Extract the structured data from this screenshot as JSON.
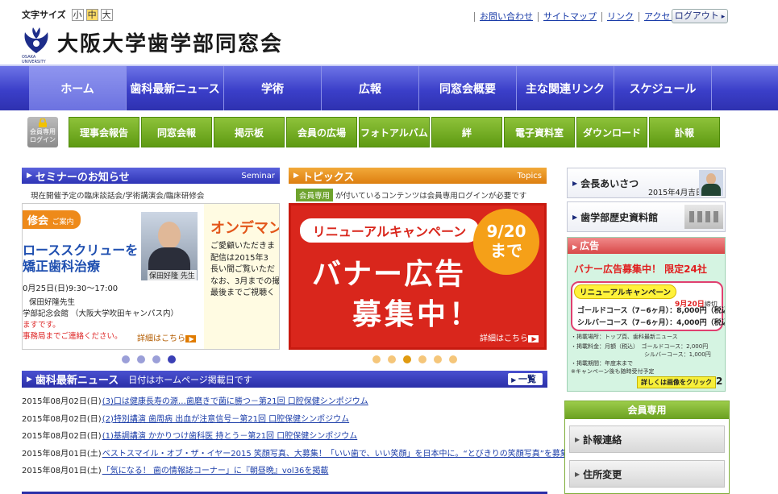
{
  "header": {
    "font_size_label": "文字サイズ",
    "font_sizes": [
      "小",
      "中",
      "大"
    ],
    "logo_text": "大阪大学歯学部同窓会",
    "logo_sub": "OSAKA UNIVERSITY",
    "top_links": [
      "お問い合わせ",
      "サイトマップ",
      "リンク",
      "アクセス"
    ],
    "logout_label": "ログアウト"
  },
  "main_nav": [
    "ホーム",
    "歯科最新ニュース",
    "学術",
    "広報",
    "同窓会概要",
    "主な関連リンク",
    "スケジュール"
  ],
  "sub_nav": {
    "member_login": [
      "会員専用",
      "ログイン"
    ],
    "items": [
      "理事会報告",
      "同窓会報",
      "掲示板",
      "会員の広場",
      "フォトアルバム",
      "絆",
      "電子資料室",
      "ダウンロード",
      "訃報"
    ]
  },
  "seminar": {
    "title": "セミナーのお知らせ",
    "eng": "Seminar",
    "note": "現在開催予定の臨床談話会/学術講演会/臨床研修会",
    "banner": {
      "tag": "修会",
      "tag_small": "ご案内",
      "title_line1": "ローススクリューを",
      "title_line2": "矯正歯科治療",
      "date": "0月25日(日)9:30～17:00",
      "lecturer": "保田好隆先生",
      "venue": "学部記念会館 （大阪大学吹田キャンパス内）",
      "note1": "ますです。",
      "note2": "事務局までご連絡ください。",
      "photo_caption": "保田好隆 先生",
      "more": "詳細はこちら",
      "ondemand": "オンデマン",
      "od_lines": [
        "ご愛顧いただきま",
        "配信は2015年3",
        "長い間ご覧いただ",
        "なお、3月までの撮",
        "最後までご視聴く"
      ]
    }
  },
  "topics": {
    "title": "トピックス",
    "eng": "Topics",
    "member_badge": "会員専用",
    "note": "が付いているコンテンツは会員専用ログインが必要です",
    "banner": {
      "campaign": "リニューアルキャンペーン",
      "date_line1": "9/20",
      "date_line2": "まで",
      "big1": "バナー広告",
      "big2": "募集中！",
      "more": "詳細はこちら"
    }
  },
  "seminar_dots": {
    "count": 4,
    "active": 3,
    "color": "#9b9fd8",
    "active_color": "#3a3fb5"
  },
  "topics_dots": {
    "count": 6,
    "active": 2,
    "color": "#f5c67a",
    "active_color": "#e09a10"
  },
  "news": {
    "title": "歯科最新ニュース",
    "subtitle": "日付はホームページ掲載日です",
    "all_label": "一覧",
    "items": [
      {
        "date": "2015年08月02日(日)",
        "text": "(3)口は健康長寿の源…歯磨きで菌に勝つ－第21回 口腔保健シンポジウム"
      },
      {
        "date": "2015年08月02日(日)",
        "text": "(2)特別講演 歯周病 出血が注意信号－第21回 口腔保健シンポジウム"
      },
      {
        "date": "2015年08月02日(日)",
        "text": "(1)基調講演 かかりつけ歯科医 持とう－第21回 口腔保健シンポジウム"
      },
      {
        "date": "2015年08月01日(土)",
        "text": "ベストスマイル・オブ・ザ・イヤー2015 笑顔写真、大募集！「いい歯で、いい笑顔」を日本中に。“とびきりの笑顔写真”を募集"
      },
      {
        "date": "2015年08月01日(土)",
        "text": "「気になる！ 歯の情報誌コーナー」に『朝昼晩』vol36を掲載"
      }
    ]
  },
  "right": {
    "greeting": {
      "title": "会長あいさつ",
      "date": "2015年4月吉日"
    },
    "history": {
      "title": "歯学部歴史資料館"
    },
    "ad": {
      "head": "広告",
      "title": "バナー広告募集中！ 限定24社",
      "pill": "リニューアルキャンペーン",
      "deadline": "9月20日",
      "deadline_suffix": "締切",
      "gold": "ゴールドコース（7−6ヶ月）：8,000円（税込）",
      "silver": "シルバーコース（7−6ヶ月）：4,000円（税込）",
      "small1": "・掲載場所：トップ頁、歯科最新ニュース",
      "small2": "・掲載料金：月額（税込）　ゴールドコース：2,000円",
      "small3": "　　　　　　　　　　　　　シルバーコース：1,000円",
      "small4": "・掲載期間：年度末まで",
      "small5": "※キャンペーン後も随時受付予定",
      "click": "詳しくは画像をクリック",
      "num": "2"
    },
    "member": {
      "head": "会員専用",
      "items": [
        "訃報連絡",
        "住所変更"
      ]
    }
  },
  "colors": {
    "nav_blue": "#3b3fc9",
    "sub_green": "#6aa020",
    "topic_red": "#d9261c",
    "topic_orange": "#dd7f10",
    "link_blue": "#1a3ca8"
  }
}
